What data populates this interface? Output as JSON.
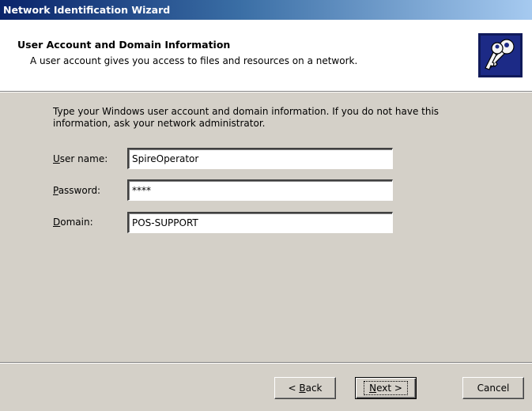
{
  "window": {
    "title": "Network Identification Wizard"
  },
  "header": {
    "title": "User Account and Domain Information",
    "subtitle": "A user account gives you access to files and resources on a network.",
    "icon": "keys-icon"
  },
  "body": {
    "intro_line1": "Type your Windows user account and domain information. If you do not have this",
    "intro_line2": "information, ask your network administrator."
  },
  "form": {
    "username": {
      "label_accel": "U",
      "label_rest": "ser name:",
      "value": "SpireOperator"
    },
    "password": {
      "label_accel": "P",
      "label_rest": "assword:",
      "value": "****"
    },
    "domain": {
      "label_accel": "D",
      "label_rest": "omain:",
      "value": "POS-SUPPORT"
    }
  },
  "buttons": {
    "back": {
      "prefix": "< ",
      "accel": "B",
      "rest": "ack"
    },
    "next": {
      "accel": "N",
      "rest": "ext >"
    },
    "cancel": "Cancel"
  }
}
